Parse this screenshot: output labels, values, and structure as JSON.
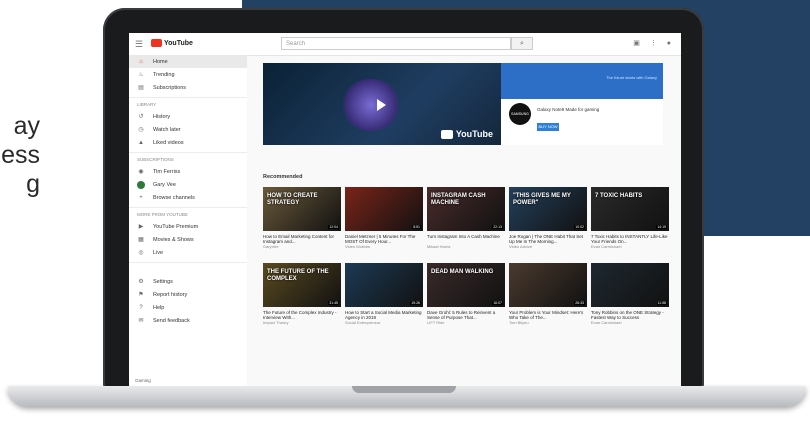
{
  "left_text": [
    "ay",
    "ess",
    "g"
  ],
  "topbar": {
    "logo": "YouTube",
    "search_placeholder": "Search",
    "search_icon": "search-icon"
  },
  "sidebar": {
    "main_items": [
      {
        "label": "Home",
        "icon": "home-icon",
        "active": true
      },
      {
        "label": "Trending",
        "icon": "fire-icon"
      },
      {
        "label": "Subscriptions",
        "icon": "subscriptions-icon"
      }
    ],
    "library_head": "LIBRARY",
    "library_items": [
      {
        "label": "History",
        "icon": "history-icon"
      },
      {
        "label": "Watch later",
        "icon": "clock-icon"
      },
      {
        "label": "Liked videos",
        "icon": "thumb-icon"
      }
    ],
    "subs_head": "SUBSCRIPTIONS",
    "subs_items": [
      {
        "label": "Tim Ferriss",
        "icon": "avatar"
      },
      {
        "label": "Gary Vee",
        "icon": "avatar"
      },
      {
        "label": "Browse channels",
        "icon": "plus-icon"
      }
    ],
    "more_head": "MORE FROM YOUTUBE",
    "more_items": [
      {
        "label": "YouTube Premium",
        "icon": "premium-icon"
      },
      {
        "label": "Movies & Shows",
        "icon": "film-icon"
      },
      {
        "label": "Live",
        "icon": "live-icon"
      }
    ],
    "settings_items": [
      {
        "label": "Settings",
        "icon": "gear-icon"
      },
      {
        "label": "Report history",
        "icon": "flag-icon"
      },
      {
        "label": "Help",
        "icon": "help-icon"
      },
      {
        "label": "Send feedback",
        "icon": "feedback-icon"
      }
    ]
  },
  "banner": {
    "watermark": "YouTube",
    "ad_top_text": "The future starts with Galaxy",
    "ad_logo": "SAMSUNG",
    "ad_title": "Galaxy Note9 Made for gaming",
    "ad_button": "BUY NOW"
  },
  "section_title": "Recommended",
  "rows": [
    [
      {
        "cap": "HOW TO CREATE STRATEGY",
        "title": "How to Email Marketing Content for Instagram and...",
        "meta": "GaryVee",
        "dur": "12:04",
        "color": "#6b5a3a"
      },
      {
        "cap": "",
        "title": "Daniel Metzner | 5 Minutes For The MOST Of Every Hour...",
        "meta": "Video Motives",
        "dur": "8:51",
        "color": "#7a2418"
      },
      {
        "cap": "INSTAGRAM CASH MACHINE",
        "title": "Turn Instagram Into A Cash Machine",
        "meta": "Mikael Harris",
        "dur": "22:13",
        "color": "#4a2b2b"
      },
      {
        "cap": "\"THIS GIVES ME MY POWER\"",
        "title": "Joe Rogan | The ONE Habit That Set Up Me In The Morning...",
        "meta": "Video Advice",
        "dur": "10:02",
        "color": "#23405c"
      },
      {
        "cap": "7 TOXIC HABITS",
        "title": "7 Toxic Habits to INSTANTLY Life-Like Your Friends On...",
        "meta": "Evan Carmichael",
        "dur": "14:19",
        "color": "#2a2a2a"
      }
    ],
    [
      {
        "cap": "THE FUTURE OF THE COMPLEX",
        "title": "The Future of the Complex Industry - Interview With...",
        "meta": "Impact Theory",
        "dur": "31:45",
        "color": "#5a4a20"
      },
      {
        "cap": "",
        "title": "How to Start a Social Media Marketing Agency in 2019",
        "meta": "Social Entrepreneur",
        "dur": "19:26",
        "color": "#1c3a55"
      },
      {
        "cap": "DEAD MAN WALKING",
        "title": "Dave Grohl: 5 Rules to Reinvent a Sense of Purpose That...",
        "meta": "LIFT Ride",
        "dur": "16:07",
        "color": "#3a2a2a"
      },
      {
        "cap": "",
        "title": "Your Problem is Your Mindset: Here's Who Take of The...",
        "meta": "Tom Bilyeu",
        "dur": "28:33",
        "color": "#4a3a2e"
      },
      {
        "cap": "",
        "title": "Tony Robbins on the ONE Strategy - Fastest Way to Success",
        "meta": "Evan Carmichael",
        "dur": "11:58",
        "color": "#1e2830"
      }
    ]
  ],
  "footer_text": "Gaming"
}
